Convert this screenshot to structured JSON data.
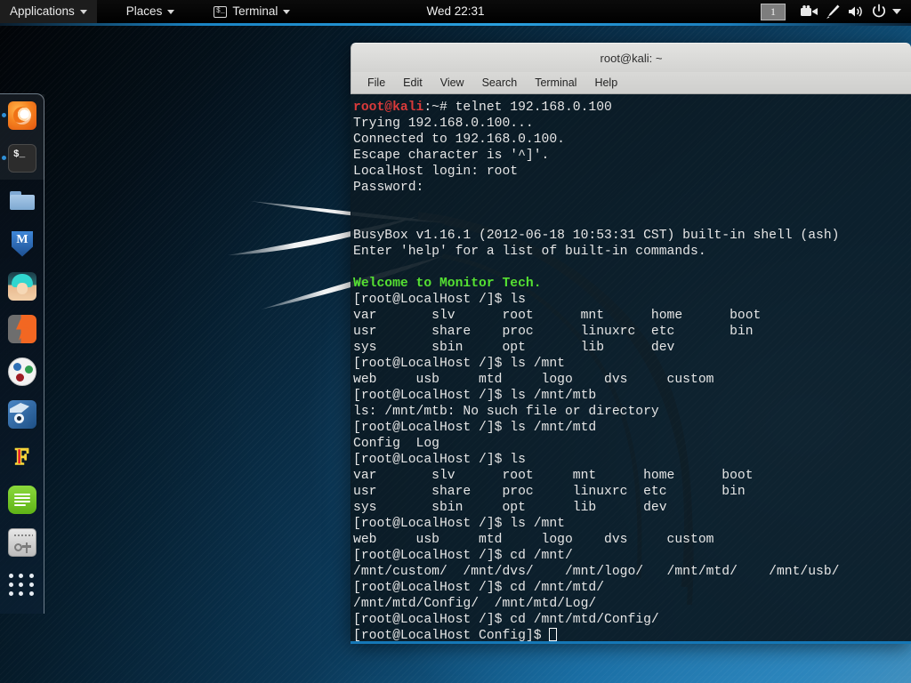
{
  "panel": {
    "applications_label": "Applications",
    "places_label": "Places",
    "terminal_label": "Terminal",
    "terminal_icon_glyph": "$_",
    "clock": "Wed 22:31",
    "workspace": "1",
    "tray_icons": [
      "video-camera-icon",
      "brush-icon",
      "volume-icon",
      "power-icon",
      "chevron-down-icon"
    ]
  },
  "dock": {
    "items": [
      {
        "name": "firefox",
        "label": "Firefox ESR",
        "running": true
      },
      {
        "name": "terminal",
        "label": "Terminal",
        "running": true
      },
      {
        "name": "files",
        "label": "Files",
        "running": false
      },
      {
        "name": "metasploit",
        "label": "Metasploit Framework",
        "running": false
      },
      {
        "name": "armitage",
        "label": "Armitage",
        "running": false
      },
      {
        "name": "burpsuite",
        "label": "Burp Suite",
        "running": false
      },
      {
        "name": "beef",
        "label": "BeEF",
        "running": false
      },
      {
        "name": "wireshark",
        "label": "Wireshark",
        "running": false
      },
      {
        "name": "faraday",
        "label": "Faraday IDE",
        "running": false
      },
      {
        "name": "text-editor",
        "label": "Text Editor",
        "running": false
      },
      {
        "name": "settings",
        "label": "Settings",
        "running": false
      },
      {
        "name": "show-applications",
        "label": "Show Applications",
        "running": false
      }
    ]
  },
  "terminal": {
    "title": "root@kali: ~",
    "menu": [
      "File",
      "Edit",
      "View",
      "Search",
      "Terminal",
      "Help"
    ],
    "prompt_user_host": "root@kali",
    "prompt_tail": ":~# ",
    "colors": {
      "prompt": "#d93a3a",
      "banner": "#55e032",
      "text": "#e6e6e6",
      "background": "#0b1a24"
    },
    "lines": [
      {
        "type": "prompt",
        "prompt": "root@kali",
        "tail": ":~# ",
        "cmd": "telnet 192.168.0.100"
      },
      {
        "type": "out",
        "text": "Trying 192.168.0.100..."
      },
      {
        "type": "out",
        "text": "Connected to 192.168.0.100."
      },
      {
        "type": "out",
        "text": "Escape character is '^]'."
      },
      {
        "type": "out",
        "text": "LocalHost login: root"
      },
      {
        "type": "out",
        "text": "Password:"
      },
      {
        "type": "out",
        "text": ""
      },
      {
        "type": "out",
        "text": ""
      },
      {
        "type": "out",
        "text": "BusyBox v1.16.1 (2012-06-18 10:53:31 CST) built-in shell (ash)"
      },
      {
        "type": "out",
        "text": "Enter 'help' for a list of built-in commands."
      },
      {
        "type": "out",
        "text": ""
      },
      {
        "type": "banner",
        "text": "Welcome to Monitor Tech."
      },
      {
        "type": "out",
        "text": "[root@LocalHost /]$ ls"
      },
      {
        "type": "out",
        "text": "var       slv      root      mnt      home      boot"
      },
      {
        "type": "out",
        "text": "usr       share    proc      linuxrc  etc       bin"
      },
      {
        "type": "out",
        "text": "sys       sbin     opt       lib      dev"
      },
      {
        "type": "out",
        "text": "[root@LocalHost /]$ ls /mnt"
      },
      {
        "type": "out",
        "text": "web     usb     mtd     logo    dvs     custom"
      },
      {
        "type": "out",
        "text": "[root@LocalHost /]$ ls /mnt/mtb"
      },
      {
        "type": "out",
        "text": "ls: /mnt/mtb: No such file or directory"
      },
      {
        "type": "out",
        "text": "[root@LocalHost /]$ ls /mnt/mtd"
      },
      {
        "type": "out",
        "text": "Config  Log"
      },
      {
        "type": "out",
        "text": "[root@LocalHost /]$ ls"
      },
      {
        "type": "out",
        "text": "var       slv      root     mnt      home      boot"
      },
      {
        "type": "out",
        "text": "usr       share    proc     linuxrc  etc       bin"
      },
      {
        "type": "out",
        "text": "sys       sbin     opt      lib      dev"
      },
      {
        "type": "out",
        "text": "[root@LocalHost /]$ ls /mnt"
      },
      {
        "type": "out",
        "text": "web     usb     mtd     logo    dvs     custom"
      },
      {
        "type": "out",
        "text": "[root@LocalHost /]$ cd /mnt/"
      },
      {
        "type": "out",
        "text": "/mnt/custom/  /mnt/dvs/    /mnt/logo/   /mnt/mtd/    /mnt/usb/"
      },
      {
        "type": "out",
        "text": "[root@LocalHost /]$ cd /mnt/mtd/"
      },
      {
        "type": "out",
        "text": "/mnt/mtd/Config/  /mnt/mtd/Log/"
      },
      {
        "type": "out",
        "text": "[root@LocalHost /]$ cd /mnt/mtd/Config/"
      },
      {
        "type": "cursor",
        "text": "[root@LocalHost Config]$ "
      }
    ]
  }
}
